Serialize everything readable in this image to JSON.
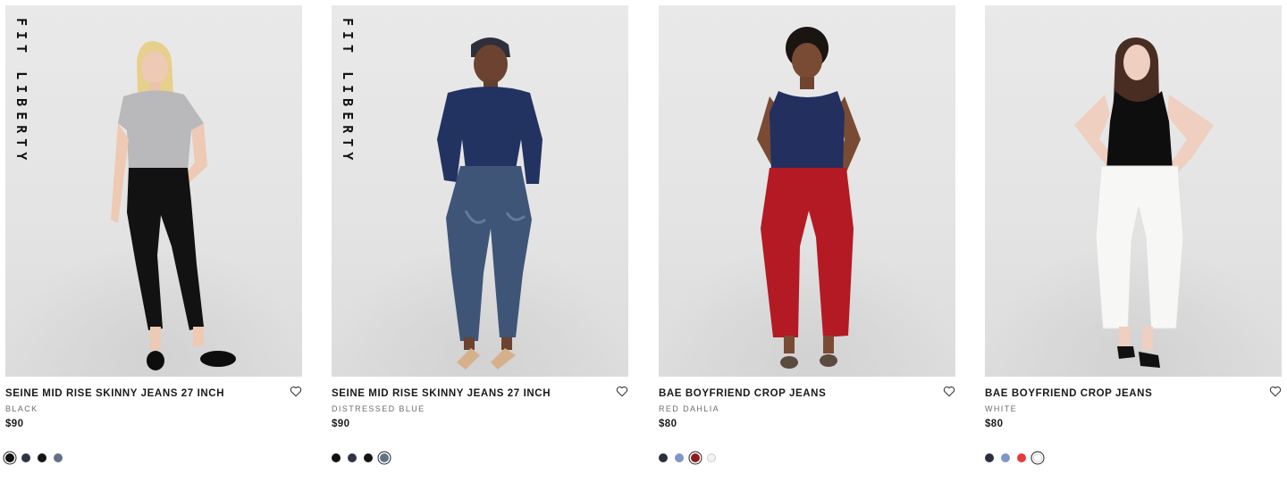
{
  "products": [
    {
      "badge": "FIT LIBERTY",
      "title": "SEINE MID RISE SKINNY JEANS 27 INCH",
      "color": "BLACK",
      "price": "$90",
      "swatches": [
        "#111111",
        "#2e3447",
        "#151515",
        "#5f7385"
      ],
      "selected_swatch": 0,
      "favorite_icon": "heart-outline-icon"
    },
    {
      "badge": "FIT LIBERTY",
      "title": "SEINE MID RISE SKINNY JEANS 27 INCH",
      "color": "DISTRESSED BLUE",
      "price": "$90",
      "swatches": [
        "#111111",
        "#2e3447",
        "#151515",
        "#5f7385"
      ],
      "selected_swatch": 3,
      "favorite_icon": "heart-outline-icon"
    },
    {
      "badge": "",
      "title": "BAE BOYFRIEND CROP JEANS",
      "color": "RED DAHLIA",
      "price": "$80",
      "swatches": [
        "#2b3040",
        "#7f97c6",
        "#8c1c22",
        "#f2f2f2"
      ],
      "selected_swatch": 2,
      "favorite_icon": "heart-outline-icon"
    },
    {
      "badge": "",
      "title": "BAE BOYFRIEND CROP JEANS",
      "color": "WHITE",
      "price": "$80",
      "swatches": [
        "#2b3040",
        "#7f97c6",
        "#e53b3b",
        "#ffffff"
      ],
      "selected_swatch": 3,
      "favorite_icon": "heart-outline-icon"
    }
  ]
}
